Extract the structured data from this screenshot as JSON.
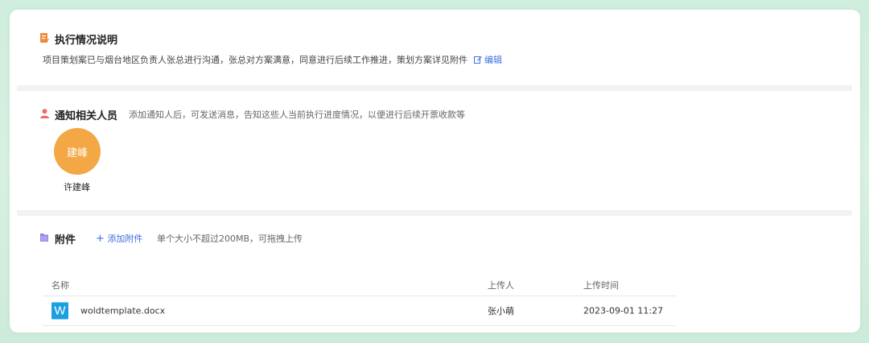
{
  "execution": {
    "title": "执行情况说明",
    "description": "项目策划案已与烟台地区负责人张总进行沟通，张总对方案满意，同意进行后续工作推进，策划方案详见附件",
    "edit_label": "编辑"
  },
  "notify": {
    "title": "通知相关人员",
    "hint": "添加通知人后，可发送消息，告知这些人当前执行进度情况，以便进行后续开票收款等",
    "people": [
      {
        "avatar_text": "建峰",
        "name": "许建峰"
      }
    ]
  },
  "attachments": {
    "title": "附件",
    "add_label": "添加附件",
    "hint": "单个大小不超过200MB，可拖拽上传",
    "columns": [
      "名称",
      "上传人",
      "上传时间"
    ],
    "rows": [
      {
        "icon_letter": "W",
        "name": "woldtemplate.docx",
        "uploader": "张小萌",
        "time": "2023-09-01 11:27"
      }
    ]
  },
  "colors": {
    "accent": "#3d6fe0",
    "avatar": "#f4a845",
    "word_icon": "#1a9fe0",
    "exec_icon": "#f08a3c",
    "notify_icon": "#ef6b6b",
    "attach_icon": "#8f86e3"
  }
}
